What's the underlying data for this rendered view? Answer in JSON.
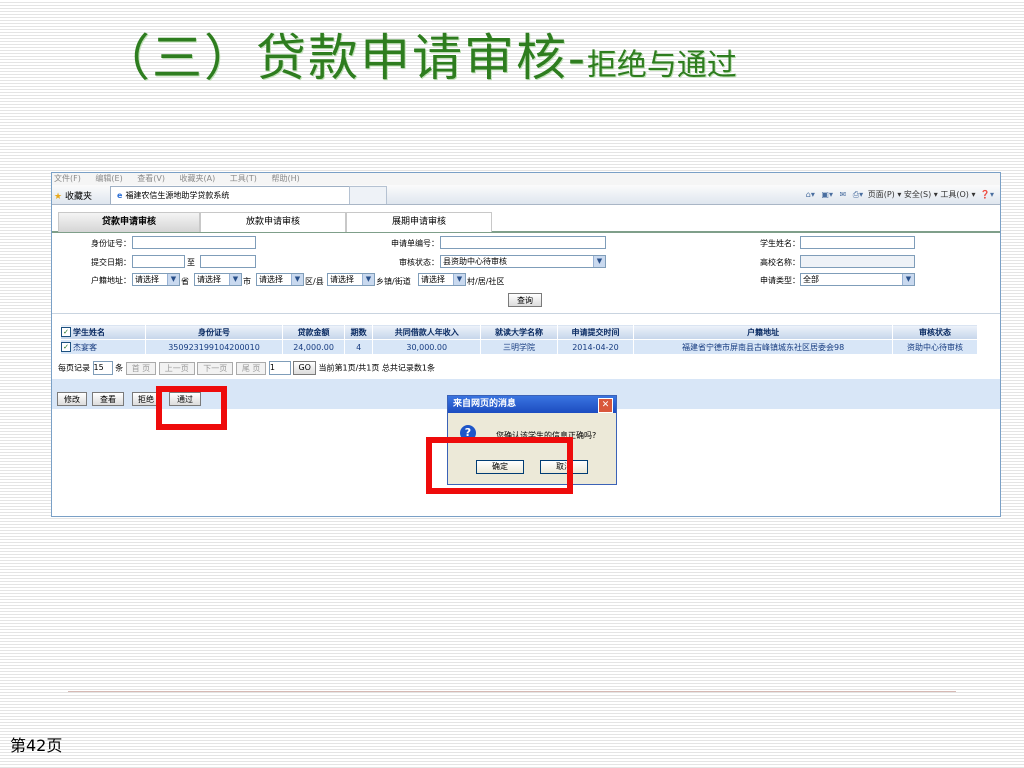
{
  "slide": {
    "title_main": "（三）贷款申请审核-",
    "title_sub": "拒绝与通过",
    "page_label": "第42页"
  },
  "browser": {
    "menu": [
      "文件(F)",
      "编辑(E)",
      "查看(V)",
      "收藏夹(A)",
      "工具(T)",
      "帮助(H)"
    ],
    "favorites_label": "收藏夹",
    "tab_title": "福建农信生源地助学贷款系统",
    "tools": {
      "page": "页面(P)",
      "safety": "安全(S)",
      "tools": "工具(O)"
    }
  },
  "nav_tabs": [
    "贷款申请审核",
    "放款申请审核",
    "展期申请审核"
  ],
  "form": {
    "id_label": "身份证号：",
    "apply_no_label": "申请单编号：",
    "student_name_label": "学生姓名：",
    "submit_date_label": "提交日期：",
    "to_label": "至",
    "review_status_label": "审核状态：",
    "review_status_value": "县资助中心待审核",
    "school_label": "高校名称：",
    "address_label": "户籍地址：",
    "select_placeholder": "请选择",
    "unit_province": "省",
    "unit_city": "市",
    "unit_district": "区/县",
    "unit_town": "乡镇/街道",
    "unit_village": "村/居/社区",
    "apply_type_label": "申请类型：",
    "apply_type_value": "全部",
    "query_button": "查询"
  },
  "table": {
    "columns": [
      "学生姓名",
      "身份证号",
      "贷款金额",
      "期数",
      "共同借款人年收入",
      "就读大学名称",
      "申请提交时间",
      "户籍地址",
      "审核状态"
    ],
    "rows": [
      [
        "杰宴客",
        "350923199104200010",
        "24,000.00",
        "4",
        "30,000.00",
        "三明学院",
        "2014-04-20",
        "福建省宁德市屏南县古峰镇城东社区居委会98",
        "资助中心待审核"
      ]
    ]
  },
  "pager": {
    "per_page_label": "每页记录",
    "per_page_value": "15",
    "unit": "条",
    "first": "首 页",
    "prev": "上一页",
    "next": "下一页",
    "last": "尾 页",
    "page_value": "1",
    "go": "GO",
    "summary": "当前第1页/共1页 总共记录数1条"
  },
  "actions": [
    "修改",
    "查看",
    "拒绝",
    "通过"
  ],
  "dialog": {
    "title": "来自网页的消息",
    "message": "您确认该学生的信息正确吗?",
    "ok": "确定",
    "cancel": "取消"
  },
  "colors": {
    "title_green": "#2e7d1f",
    "highlight_red": "#ee0b0b",
    "grid_row": "#d8e6f7"
  }
}
